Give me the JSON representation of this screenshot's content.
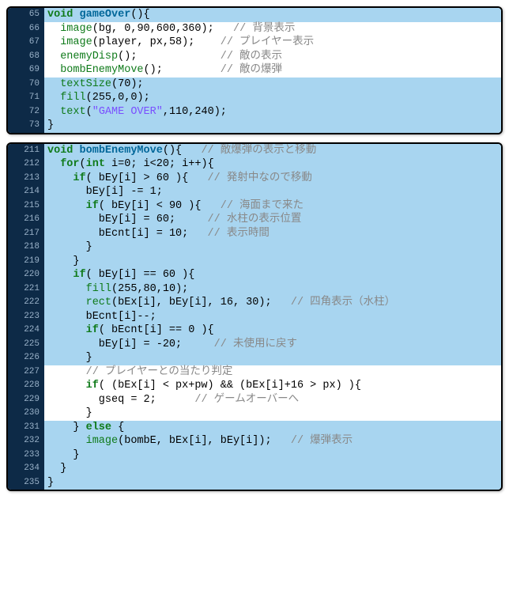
{
  "block1": {
    "lines": [
      {
        "n": 65,
        "hl": true,
        "segs": [
          [
            "kw",
            "void "
          ],
          [
            "decl",
            "gameOver"
          ],
          [
            "op",
            "(){"
          ]
        ]
      },
      {
        "n": 66,
        "hl": false,
        "segs": [
          [
            "op",
            "  "
          ],
          [
            "fn",
            "image"
          ],
          [
            "op",
            "(bg, "
          ],
          [
            "num",
            "0"
          ],
          [
            "op",
            ","
          ],
          [
            "num",
            "90"
          ],
          [
            "op",
            ","
          ],
          [
            "num",
            "600"
          ],
          [
            "op",
            ","
          ],
          [
            "num",
            "360"
          ],
          [
            "op",
            ");   "
          ],
          [
            "cmt",
            "// 背景表示"
          ]
        ]
      },
      {
        "n": 67,
        "hl": false,
        "segs": [
          [
            "op",
            "  "
          ],
          [
            "fn",
            "image"
          ],
          [
            "op",
            "(player, px,"
          ],
          [
            "num",
            "58"
          ],
          [
            "op",
            ");    "
          ],
          [
            "cmt",
            "// プレイヤー表示"
          ]
        ]
      },
      {
        "n": 68,
        "hl": false,
        "segs": [
          [
            "op",
            "  "
          ],
          [
            "fn",
            "enemyDisp"
          ],
          [
            "op",
            "();             "
          ],
          [
            "cmt",
            "// 敵の表示"
          ]
        ]
      },
      {
        "n": 69,
        "hl": false,
        "segs": [
          [
            "op",
            "  "
          ],
          [
            "fn",
            "bombEnemyMove"
          ],
          [
            "op",
            "();         "
          ],
          [
            "cmt",
            "// 敵の爆弾"
          ]
        ]
      },
      {
        "n": 70,
        "hl": true,
        "segs": [
          [
            "op",
            "  "
          ],
          [
            "fn",
            "textSize"
          ],
          [
            "op",
            "("
          ],
          [
            "num",
            "70"
          ],
          [
            "op",
            ");"
          ]
        ]
      },
      {
        "n": 71,
        "hl": true,
        "segs": [
          [
            "op",
            "  "
          ],
          [
            "fn",
            "fill"
          ],
          [
            "op",
            "("
          ],
          [
            "num",
            "255"
          ],
          [
            "op",
            ","
          ],
          [
            "num",
            "0"
          ],
          [
            "op",
            ","
          ],
          [
            "num",
            "0"
          ],
          [
            "op",
            ");"
          ]
        ]
      },
      {
        "n": 72,
        "hl": true,
        "segs": [
          [
            "op",
            "  "
          ],
          [
            "fn",
            "text"
          ],
          [
            "op",
            "("
          ],
          [
            "str",
            "\"GAME OVER\""
          ],
          [
            "op",
            ","
          ],
          [
            "num",
            "110"
          ],
          [
            "op",
            ","
          ],
          [
            "num",
            "240"
          ],
          [
            "op",
            ");"
          ]
        ]
      },
      {
        "n": 73,
        "hl": true,
        "segs": [
          [
            "op",
            "}"
          ]
        ]
      }
    ]
  },
  "block2": {
    "lines": [
      {
        "n": 211,
        "hl": true,
        "segs": [
          [
            "kw",
            "void "
          ],
          [
            "decl",
            "bombEnemyMove"
          ],
          [
            "op",
            "(){   "
          ],
          [
            "cmt",
            "// 敵爆弾の表示と移動"
          ]
        ]
      },
      {
        "n": 212,
        "hl": true,
        "segs": [
          [
            "op",
            "  "
          ],
          [
            "kw",
            "for"
          ],
          [
            "op",
            "("
          ],
          [
            "kw",
            "int"
          ],
          [
            "op",
            " i="
          ],
          [
            "num",
            "0"
          ],
          [
            "op",
            "; i<"
          ],
          [
            "num",
            "20"
          ],
          [
            "op",
            "; i++){"
          ]
        ]
      },
      {
        "n": 213,
        "hl": true,
        "segs": [
          [
            "op",
            "    "
          ],
          [
            "kw",
            "if"
          ],
          [
            "op",
            "( bEy[i] > "
          ],
          [
            "num",
            "60"
          ],
          [
            "op",
            " ){   "
          ],
          [
            "cmt",
            "// 発射中なので移動"
          ]
        ]
      },
      {
        "n": 214,
        "hl": true,
        "segs": [
          [
            "op",
            "      bEy[i] -= "
          ],
          [
            "num",
            "1"
          ],
          [
            "op",
            ";"
          ]
        ]
      },
      {
        "n": 215,
        "hl": true,
        "segs": [
          [
            "op",
            "      "
          ],
          [
            "kw",
            "if"
          ],
          [
            "op",
            "( bEy[i] < "
          ],
          [
            "num",
            "90"
          ],
          [
            "op",
            " ){   "
          ],
          [
            "cmt",
            "// 海面まで来た"
          ]
        ]
      },
      {
        "n": 216,
        "hl": true,
        "segs": [
          [
            "op",
            "        bEy[i] = "
          ],
          [
            "num",
            "60"
          ],
          [
            "op",
            ";     "
          ],
          [
            "cmt",
            "// 水柱の表示位置"
          ]
        ]
      },
      {
        "n": 217,
        "hl": true,
        "segs": [
          [
            "op",
            "        bEcnt[i] = "
          ],
          [
            "num",
            "10"
          ],
          [
            "op",
            ";   "
          ],
          [
            "cmt",
            "// 表示時間"
          ]
        ]
      },
      {
        "n": 218,
        "hl": true,
        "segs": [
          [
            "op",
            "      }"
          ]
        ]
      },
      {
        "n": 219,
        "hl": true,
        "segs": [
          [
            "op",
            "    }"
          ]
        ]
      },
      {
        "n": 220,
        "hl": true,
        "segs": [
          [
            "op",
            "    "
          ],
          [
            "kw",
            "if"
          ],
          [
            "op",
            "( bEy[i] == "
          ],
          [
            "num",
            "60"
          ],
          [
            "op",
            " ){"
          ]
        ]
      },
      {
        "n": 221,
        "hl": true,
        "segs": [
          [
            "op",
            "      "
          ],
          [
            "fn",
            "fill"
          ],
          [
            "op",
            "("
          ],
          [
            "num",
            "255"
          ],
          [
            "op",
            ","
          ],
          [
            "num",
            "80"
          ],
          [
            "op",
            ","
          ],
          [
            "num",
            "10"
          ],
          [
            "op",
            ");"
          ]
        ]
      },
      {
        "n": 222,
        "hl": true,
        "segs": [
          [
            "op",
            "      "
          ],
          [
            "fn",
            "rect"
          ],
          [
            "op",
            "(bEx[i], bEy[i], "
          ],
          [
            "num",
            "16"
          ],
          [
            "op",
            ", "
          ],
          [
            "num",
            "30"
          ],
          [
            "op",
            ");   "
          ],
          [
            "cmt",
            "// 四角表示（水柱）"
          ]
        ]
      },
      {
        "n": 223,
        "hl": true,
        "segs": [
          [
            "op",
            "      bEcnt[i]--;"
          ]
        ]
      },
      {
        "n": 224,
        "hl": true,
        "segs": [
          [
            "op",
            "      "
          ],
          [
            "kw",
            "if"
          ],
          [
            "op",
            "( bEcnt[i] == "
          ],
          [
            "num",
            "0"
          ],
          [
            "op",
            " ){"
          ]
        ]
      },
      {
        "n": 225,
        "hl": true,
        "segs": [
          [
            "op",
            "        bEy[i] = -"
          ],
          [
            "num",
            "20"
          ],
          [
            "op",
            ";     "
          ],
          [
            "cmt",
            "// 未使用に戻す"
          ]
        ]
      },
      {
        "n": 226,
        "hl": true,
        "segs": [
          [
            "op",
            "      }"
          ]
        ]
      },
      {
        "n": 227,
        "hl": false,
        "segs": [
          [
            "op",
            "      "
          ],
          [
            "cmt",
            "// プレイヤーとの当たり判定"
          ]
        ]
      },
      {
        "n": 228,
        "hl": false,
        "segs": [
          [
            "op",
            "      "
          ],
          [
            "kw",
            "if"
          ],
          [
            "op",
            "( (bEx[i] < px+pw) && (bEx[i]+"
          ],
          [
            "num",
            "16"
          ],
          [
            "op",
            " > px) ){"
          ]
        ]
      },
      {
        "n": 229,
        "hl": false,
        "segs": [
          [
            "op",
            "        gseq = "
          ],
          [
            "num",
            "2"
          ],
          [
            "op",
            ";      "
          ],
          [
            "cmt",
            "// ゲームオーバーへ"
          ]
        ]
      },
      {
        "n": 230,
        "hl": false,
        "segs": [
          [
            "op",
            "      }"
          ]
        ]
      },
      {
        "n": 231,
        "hl": true,
        "segs": [
          [
            "op",
            "    } "
          ],
          [
            "kw",
            "else"
          ],
          [
            "op",
            " {"
          ]
        ]
      },
      {
        "n": 232,
        "hl": true,
        "segs": [
          [
            "op",
            "      "
          ],
          [
            "fn",
            "image"
          ],
          [
            "op",
            "(bombE, bEx[i], bEy[i]);   "
          ],
          [
            "cmt",
            "// 爆弾表示"
          ]
        ]
      },
      {
        "n": 233,
        "hl": true,
        "segs": [
          [
            "op",
            "    }"
          ]
        ]
      },
      {
        "n": 234,
        "hl": true,
        "segs": [
          [
            "op",
            "  }"
          ]
        ]
      },
      {
        "n": 235,
        "hl": true,
        "segs": [
          [
            "op",
            "}"
          ]
        ]
      }
    ]
  }
}
